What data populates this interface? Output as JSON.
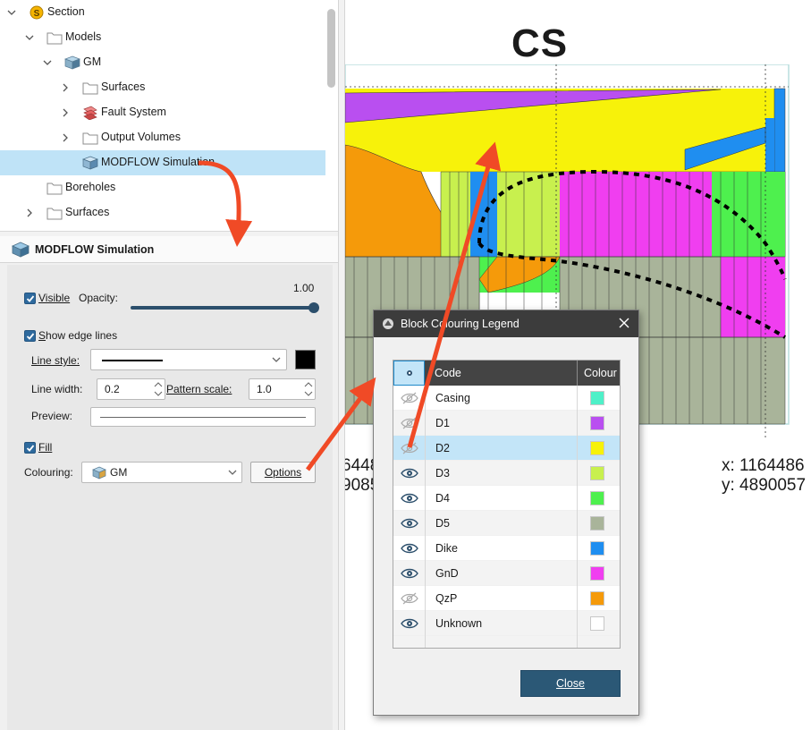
{
  "tree": {
    "items": [
      {
        "label": "Section",
        "icon": "section-icon",
        "expanded": true
      },
      {
        "label": "Models",
        "icon": "folder-icon",
        "expanded": true
      },
      {
        "label": "GM",
        "icon": "geomodel-icon",
        "expanded": true
      },
      {
        "label": "Surfaces",
        "icon": "folder-icon",
        "expanded": false
      },
      {
        "label": "Fault System",
        "icon": "fault-system-icon",
        "expanded": false
      },
      {
        "label": "Output Volumes",
        "icon": "folder-icon",
        "expanded": false
      },
      {
        "label": "MODFLOW Simulation",
        "icon": "modflow-icon",
        "selected": true
      },
      {
        "label": "Boreholes",
        "icon": "folder-icon"
      },
      {
        "label": "Surfaces",
        "icon": "folder-icon",
        "expanded": false
      }
    ]
  },
  "props": {
    "title": "MODFLOW Simulation",
    "visible_label": "Visible",
    "opacity_label": "Opacity:",
    "opacity_value": "1.00",
    "opacity_fraction": 1.0,
    "show_edges_label": "Show edge lines",
    "line_style_label": "Line style:",
    "line_width_label": "Line width:",
    "line_width_value": "0.2",
    "pattern_scale_label": "Pattern scale:",
    "pattern_scale_value": "1.0",
    "preview_label": "Preview:",
    "fill_label": "Fill",
    "colouring_label": "Colouring:",
    "colouring_value": "GM",
    "options_label": "Options",
    "edge_colour": "#000000"
  },
  "view": {
    "title": "CS",
    "coord_x_right": "x: 1164486",
    "coord_y_right": "y: 4890057",
    "coord_x_left": "6448",
    "coord_y_left": "9085"
  },
  "dialog": {
    "title": "Block Colouring Legend",
    "columns": {
      "code": "Code",
      "colour": "Colour"
    },
    "rows": [
      {
        "code": "Casing",
        "color": "#4ef0c8",
        "visible": false
      },
      {
        "code": "D1",
        "color": "#b94ff0",
        "visible": false
      },
      {
        "code": "D2",
        "color": "#f7f20a",
        "visible": false,
        "selected": true
      },
      {
        "code": "D3",
        "color": "#c8f04e",
        "visible": true
      },
      {
        "code": "D4",
        "color": "#4ef04e",
        "visible": true
      },
      {
        "code": "D5",
        "color": "#a9b49a",
        "visible": true
      },
      {
        "code": "Dike",
        "color": "#1f8ef0",
        "visible": true
      },
      {
        "code": "GnD",
        "color": "#f03ef0",
        "visible": true
      },
      {
        "code": "QzP",
        "color": "#f59a0a",
        "visible": false
      },
      {
        "code": "Unknown",
        "color": "#ffffff",
        "visible": true
      }
    ],
    "close_label": "Close"
  }
}
